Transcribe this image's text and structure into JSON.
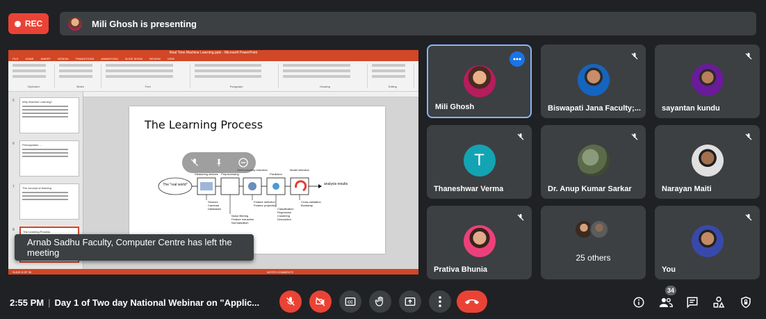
{
  "recording": {
    "label": "REC",
    "color": "#ea4335"
  },
  "presenting_banner": {
    "text": "Mili Ghosh is presenting"
  },
  "shared_screen": {
    "window_title": "Real Time Machine Learning.pptx - Microsoft PowerPoint",
    "ribbon_tabs": [
      "FILE",
      "HOME",
      "INSERT",
      "DESIGN",
      "TRANSITIONS",
      "ANIMATIONS",
      "SLIDE SHOW",
      "REVIEW",
      "VIEW"
    ],
    "ribbon_groups": [
      "Clipboard",
      "Slides",
      "Font",
      "Paragraph",
      "Drawing",
      "Editing"
    ],
    "thumbnails": [
      {
        "number": "5",
        "title": "Why Machine Learning?"
      },
      {
        "number": "6",
        "title": "Prerequisites ..."
      },
      {
        "number": "7",
        "title": "The concept of learning"
      },
      {
        "number": "8",
        "title": "The Learning Process"
      }
    ],
    "slide_title": "The Learning Process",
    "diagram": {
      "cloud": "The \"real world\"",
      "stages": [
        "Measuring devices",
        "Preprocessing",
        "Dimensionality reduction",
        "Prediction",
        "Model selection"
      ],
      "output": "analysis results",
      "notes": {
        "measuring": [
          "Sensors",
          "Cameras",
          "Databases"
        ],
        "preprocessing": [
          "Noise filtering",
          "Feature extraction",
          "Normalization"
        ],
        "dimensionality": [
          "Feature selection",
          "Feature projection"
        ],
        "prediction": [
          "Classification",
          "Regression",
          "Clustering",
          "Description"
        ],
        "model": [
          "Cross-validation",
          "Bootstrap"
        ]
      }
    },
    "status_left": "SLIDE 8 OF 35",
    "status_right": "NOTES  COMMENTS"
  },
  "toast": {
    "text": "Arnab Sadhu Faculty, Computer Centre has left the meeting"
  },
  "tiles": [
    {
      "name": "Mili Ghosh",
      "speaking": true
    },
    {
      "name": "Biswapati Jana Faculty;..."
    },
    {
      "name": "sayantan kundu"
    },
    {
      "name": "Thaneshwar Verma",
      "initial": "T",
      "avatar_color": "#12a4b3"
    },
    {
      "name": "Dr. Anup Kumar Sarkar"
    },
    {
      "name": "Narayan Maiti"
    },
    {
      "name": "Prativa Bhunia"
    },
    {
      "name": "25 others"
    },
    {
      "name": "You"
    }
  ],
  "bottom_bar": {
    "time": "2:55 PM",
    "separator": "|",
    "meeting_title": "Day 1 of Two day National Webinar on \"Applic...",
    "participants_count": "34",
    "controls": [
      "mic-off",
      "camera-off",
      "captions",
      "raise-hand",
      "present",
      "more",
      "end-call"
    ],
    "right_icons": [
      "info",
      "people",
      "chat",
      "activities",
      "host-controls"
    ]
  },
  "colors": {
    "background": "#202124",
    "tile": "#3c4043",
    "accent_blue": "#8ab4f8",
    "danger": "#ea4335",
    "ppt_orange": "#d24726"
  }
}
